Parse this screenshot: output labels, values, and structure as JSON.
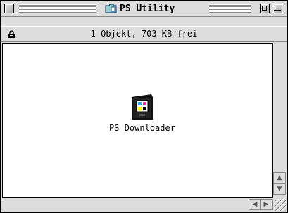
{
  "window": {
    "title": "PS Utility",
    "status_text": "1 Objekt, 703 KB frei"
  },
  "items": [
    {
      "label": "PS Downloader",
      "icon": "application-icon"
    }
  ],
  "icons": {
    "close": "close-box-icon",
    "zoom": "zoom-box-icon",
    "collapse": "collapse-box-icon",
    "lock": "lock-icon",
    "folder": "folder-icon",
    "scroll_up": "▲",
    "scroll_down": "▼",
    "scroll_left": "◀",
    "scroll_right": "▶"
  }
}
